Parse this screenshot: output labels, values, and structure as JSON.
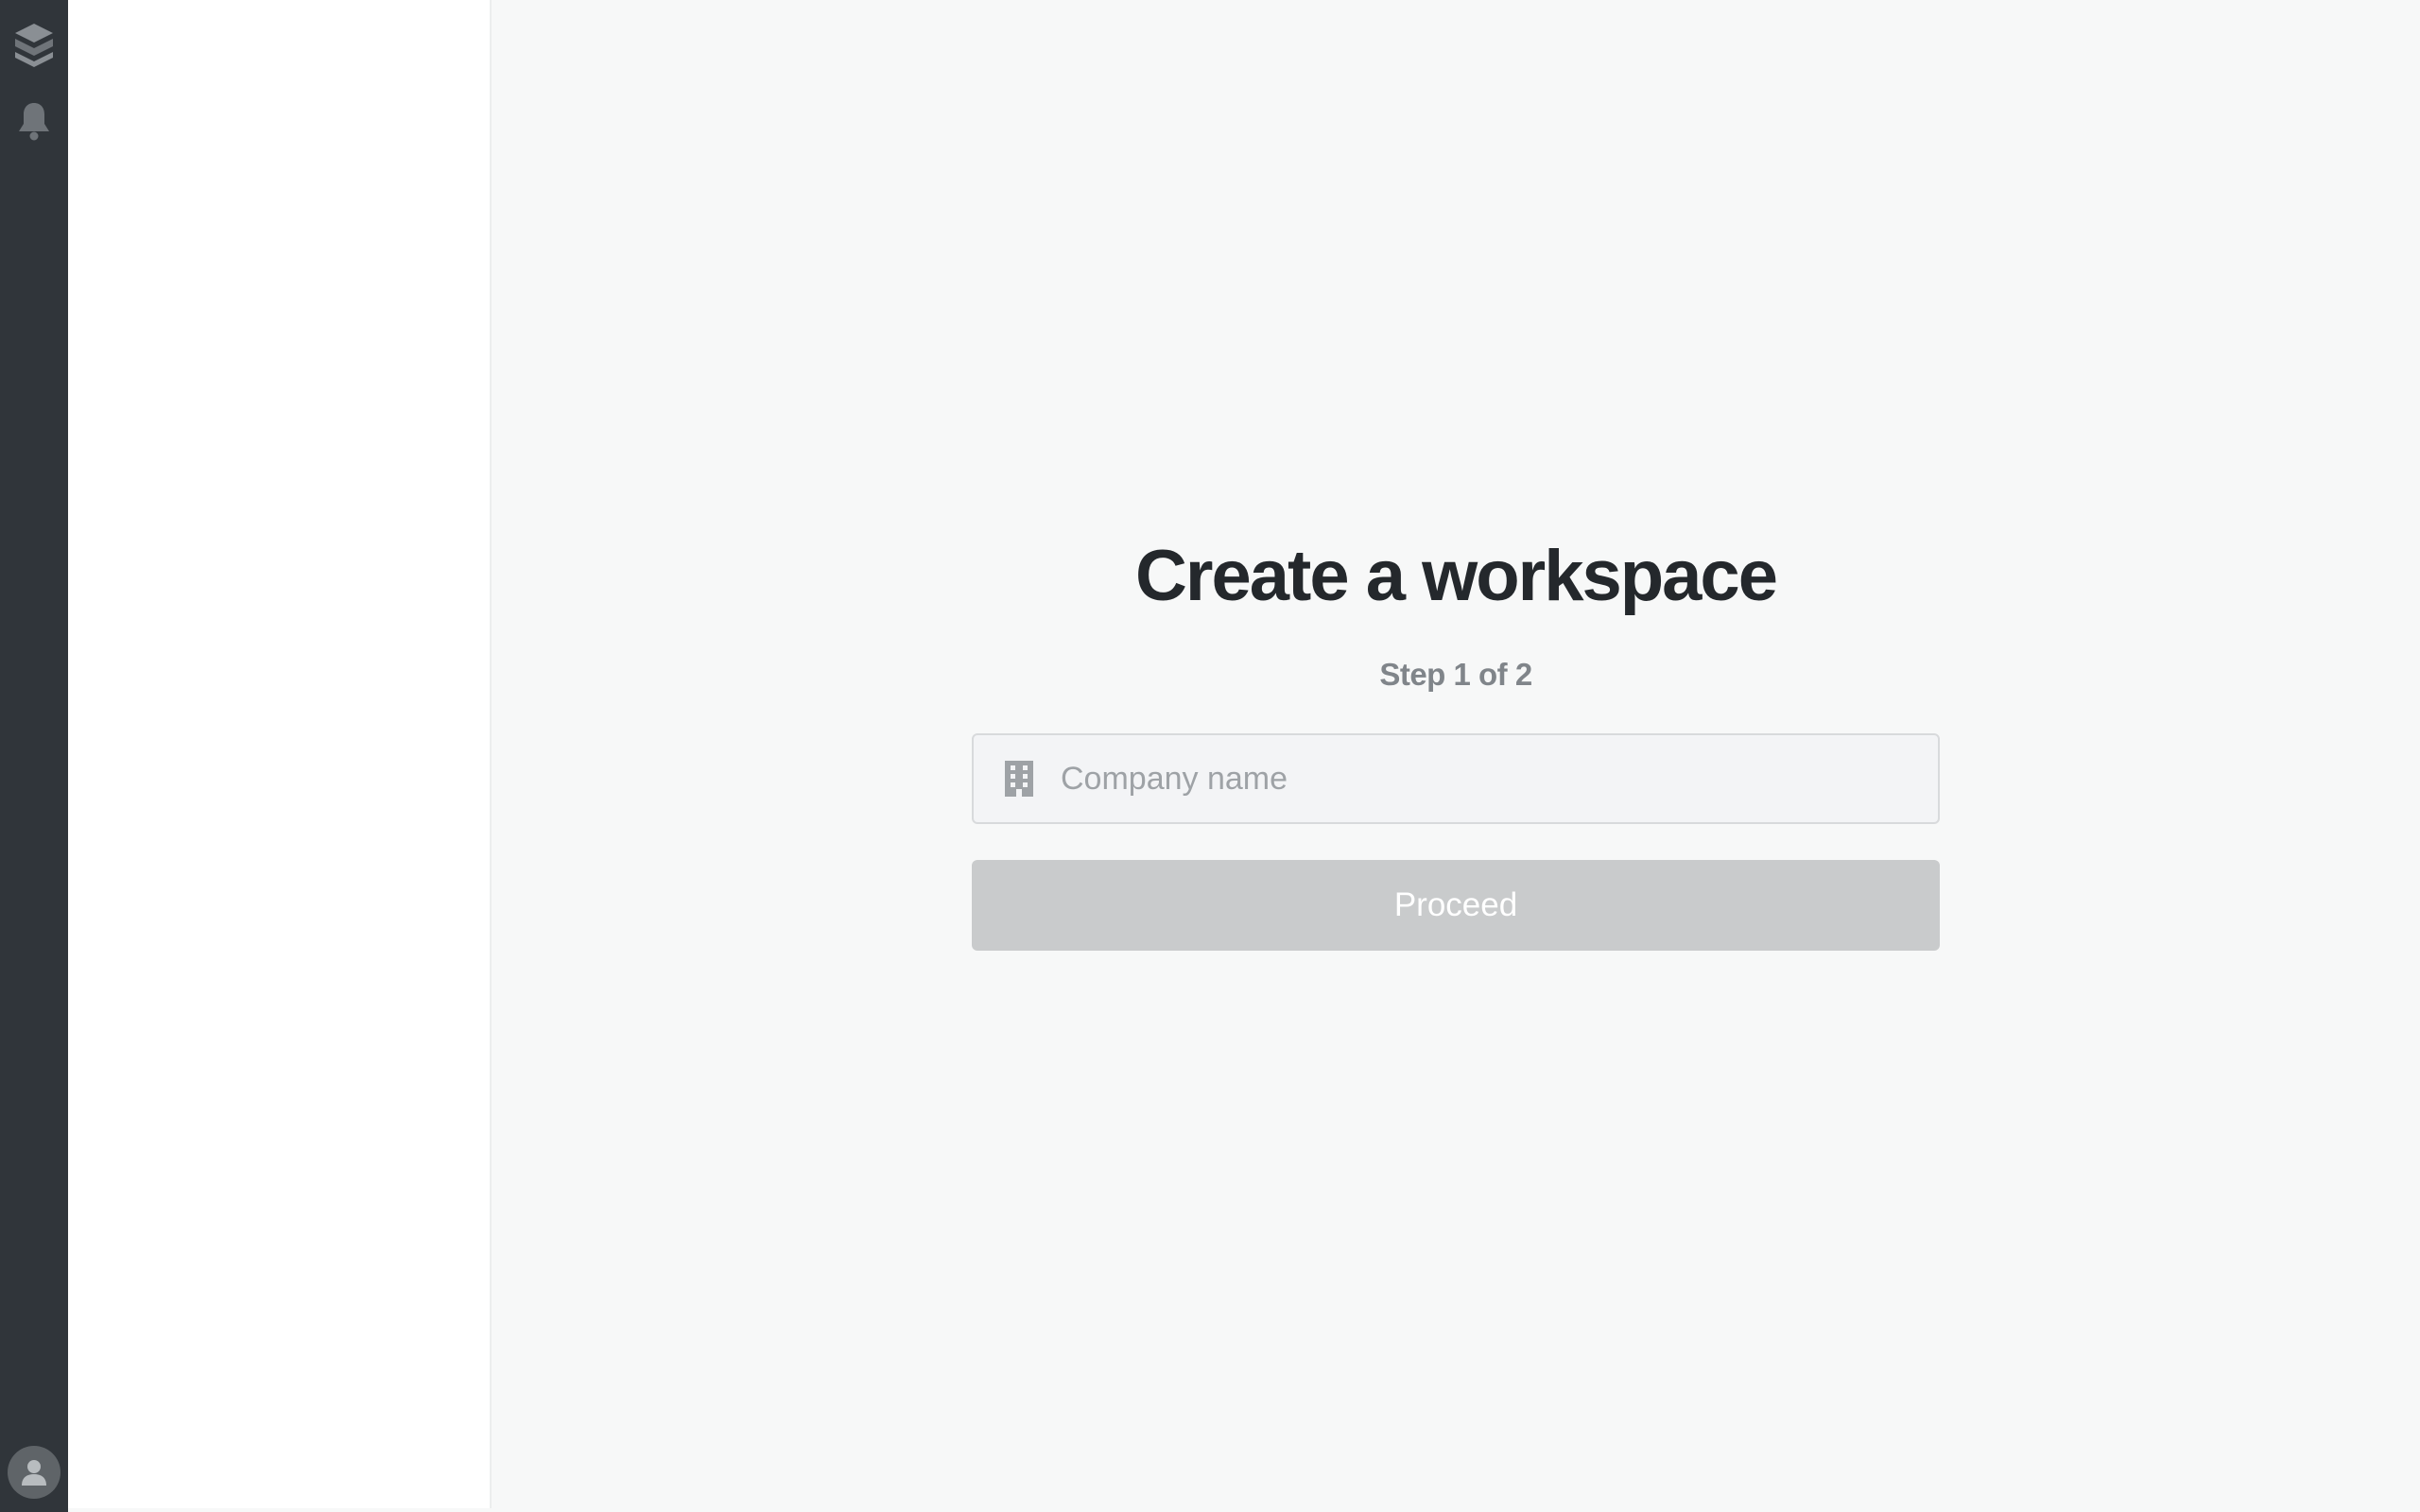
{
  "rail": {
    "icons": [
      "layers-logo-icon",
      "bell-icon",
      "user-avatar-icon"
    ],
    "background": "#30353a"
  },
  "onboarding": {
    "title": "Create a workspace",
    "step": "Step 1 of 2",
    "company_input": {
      "placeholder": "Company name",
      "value": "",
      "icon": "building-icon"
    },
    "proceed_label": "Proceed",
    "proceed_enabled": false
  },
  "colors": {
    "title": "#24282c",
    "step": "#80858a",
    "button_disabled": "#c9cbcc",
    "input_bg": "#f3f4f6",
    "page_bg": "#f7f8f8"
  }
}
